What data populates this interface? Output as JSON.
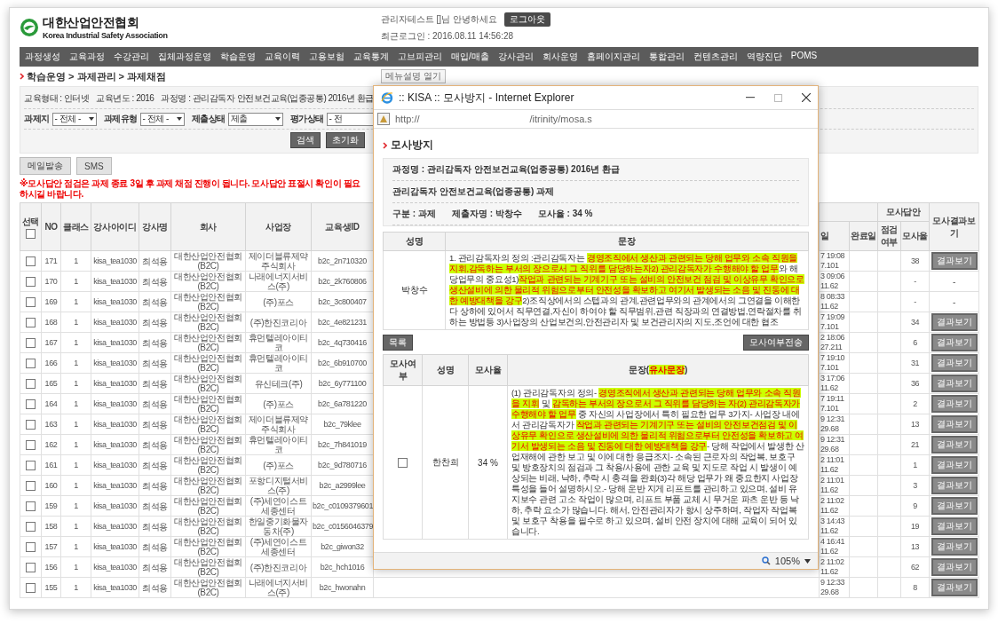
{
  "header": {
    "logo_title": "대한산업안전협회",
    "logo_subtitle": "Korea Industrial Safety Association",
    "greeting": "관리자테스트 []님 안녕하세요",
    "logout": "로그아웃",
    "last_login": "최근로그인 : 2016.08.11 14:56:28"
  },
  "menu": [
    "과정생성",
    "교육과정",
    "수강관리",
    "집체과정운영",
    "학습운영",
    "교육이력",
    "고용보험",
    "교육통계",
    "고브피관리",
    "매입/매출",
    "강사관리",
    "회사운영",
    "홈페이지관리",
    "통합관리",
    "컨텐츠관리",
    "역량진단",
    "POMS"
  ],
  "breadcrumb": "학습운영 > 과제관리 > 과제채점",
  "menu_help": "메뉴설명 열기",
  "filters": {
    "info": [
      "교육형태 : 인터넷",
      "교육년도 : 2016",
      "과정명 : 관리감독자 안전보건교육(업종공통) 2016년 환급"
    ],
    "selects": [
      {
        "label": "과제지",
        "value": "- 전체 -"
      },
      {
        "label": "과제유형",
        "value": "- 전체 -"
      },
      {
        "label": "제출상태",
        "value": "제출"
      },
      {
        "label": "평가상태",
        "value": "- 전"
      }
    ],
    "buttons": [
      "검색",
      "초기화"
    ]
  },
  "actions": [
    "메일발송",
    "SMS"
  ],
  "notice": "※모사답안 점검은 과제 종료 3일 후 과제 채점 진행이 됩니다. 모사답안 표절시 확인이 필요하시길 바랍니다.",
  "table": {
    "select_header": {
      "label": "선택",
      "checked": false
    },
    "columns_left": [
      "NO",
      "클래스",
      "강사아이디",
      "강사명",
      "회사",
      "사업장",
      "교육생ID"
    ],
    "column_9": "일",
    "completed": "완료일",
    "group_header": "모사답안",
    "group_columns": [
      "점검여부",
      "모사율"
    ],
    "result_header": "모사결과보기",
    "rows": [
      {
        "checked": false,
        "no": "171",
        "class": "1",
        "instructor_id": "kisa_tea1030",
        "instructor": "최석용",
        "company": "대한산업안전협회 (B2C)",
        "site": "제이더블류제약 주식회사",
        "student_id": "b2c_2n710320",
        "column_9": "7 19:08\n7.101",
        "rate": "38",
        "result": {
          "kind": "button",
          "label": "결과보기"
        }
      },
      {
        "checked": false,
        "no": "170",
        "class": "1",
        "instructor_id": "kisa_tea1030",
        "instructor": "최석용",
        "company": "대한산업안전협회 (B2C)",
        "site": "나래에너지서비스(주)",
        "student_id": "b2c_2k760806",
        "column_9": "3 09:06\n11.62",
        "rate": "-",
        "result": {
          "kind": "text",
          "label": "-"
        }
      },
      {
        "checked": false,
        "no": "169",
        "class": "1",
        "instructor_id": "kisa_tea1030",
        "instructor": "최석용",
        "company": "대한산업안전협회 (B2C)",
        "site": "(주)포스",
        "student_id": "b2c_3c800407",
        "column_9": "8 08:33\n11.62",
        "rate": "-",
        "result": {
          "kind": "text",
          "label": "-"
        }
      },
      {
        "checked": false,
        "no": "168",
        "class": "1",
        "instructor_id": "kisa_tea1030",
        "instructor": "최석용",
        "company": "대한산업안전협회 (B2C)",
        "site": "(주)한진코리아",
        "student_id": "b2c_4e821231",
        "column_9": "7 19:09\n7.101",
        "rate": "34",
        "result": {
          "kind": "button",
          "label": "결과보기"
        }
      },
      {
        "checked": false,
        "no": "167",
        "class": "1",
        "instructor_id": "kisa_tea1030",
        "instructor": "최석용",
        "company": "대한산업안전협회 (B2C)",
        "site": "휴먼텔레아이티코",
        "student_id": "b2c_4q730416",
        "column_9": "2 18:06\n27.211",
        "rate": "6",
        "result": {
          "kind": "button",
          "label": "결과보기"
        }
      },
      {
        "checked": false,
        "no": "166",
        "class": "1",
        "instructor_id": "kisa_tea1030",
        "instructor": "최석용",
        "company": "대한산업안전협회 (B2C)",
        "site": "휴먼텔레아이티코",
        "student_id": "b2c_6b910700",
        "column_9": "7 19:10\n7.101",
        "rate": "31",
        "result": {
          "kind": "button",
          "label": "결과보기"
        }
      },
      {
        "checked": false,
        "no": "165",
        "class": "1",
        "instructor_id": "kisa_tea1030",
        "instructor": "최석용",
        "company": "대한산업안전협회 (B2C)",
        "site": "유신테크(주)",
        "student_id": "b2c_6y771100",
        "column_9": "3 17:06\n11.62",
        "rate": "36",
        "result": {
          "kind": "button",
          "label": "결과보기"
        }
      },
      {
        "checked": false,
        "no": "164",
        "class": "1",
        "instructor_id": "kisa_tea1030",
        "instructor": "최석용",
        "company": "대한산업안전협회 (B2C)",
        "site": "(주)포스",
        "student_id": "b2c_6a781220",
        "column_9": "7 19:11\n7.101",
        "rate": "2",
        "result": {
          "kind": "button",
          "label": "결과보기"
        }
      },
      {
        "checked": false,
        "no": "163",
        "class": "1",
        "instructor_id": "kisa_tea1030",
        "instructor": "최석용",
        "company": "대한산업안전협회 (B2C)",
        "site": "제이더블류제약 주식회사",
        "student_id": "b2c_79klee",
        "column_9": "9 12:31\n29.68",
        "rate": "13",
        "result": {
          "kind": "button",
          "label": "결과보기"
        }
      },
      {
        "checked": false,
        "no": "162",
        "class": "1",
        "instructor_id": "kisa_tea1030",
        "instructor": "최석용",
        "company": "대한산업안전협회 (B2C)",
        "site": "휴먼텔레아이티코",
        "student_id": "b2c_7h841019",
        "column_9": "9 12:31\n29.68",
        "rate": "21",
        "result": {
          "kind": "button",
          "label": "결과보기"
        }
      },
      {
        "checked": false,
        "no": "161",
        "class": "1",
        "instructor_id": "kisa_tea1030",
        "instructor": "최석용",
        "company": "대한산업안전협회 (B2C)",
        "site": "(주)포스",
        "student_id": "b2c_9d780716",
        "column_9": "2 11:01\n11.62",
        "rate": "1",
        "result": {
          "kind": "button",
          "label": "결과보기"
        }
      },
      {
        "checked": false,
        "no": "160",
        "class": "1",
        "instructor_id": "kisa_tea1030",
        "instructor": "최석용",
        "company": "대한산업안전협회 (B2C)",
        "site": "포항디지털서비스(주)",
        "student_id": "b2c_a2999lee",
        "column_9": "2 11:01\n11.62",
        "rate": "3",
        "result": {
          "kind": "button",
          "label": "결과보기"
        }
      },
      {
        "checked": false,
        "no": "159",
        "class": "1",
        "instructor_id": "kisa_tea1030",
        "instructor": "최석용",
        "company": "대한산업안전협회 (B2C)",
        "site": "(주)세연이스트세종센터",
        "student_id": "b2c_c0109379601",
        "column_9": "2 11:02\n11.62",
        "rate": "9",
        "result": {
          "kind": "button",
          "label": "결과보기"
        }
      },
      {
        "checked": false,
        "no": "158",
        "class": "1",
        "instructor_id": "kisa_tea1030",
        "instructor": "최석용",
        "company": "대한산업안전협회 (B2C)",
        "site": "한일중기화물자동차(주)",
        "student_id": "b2c_c0156046379",
        "column_9": "3 14:43\n11.62",
        "rate": "19",
        "result": {
          "kind": "button",
          "label": "결과보기"
        }
      },
      {
        "checked": false,
        "no": "157",
        "class": "1",
        "instructor_id": "kisa_tea1030",
        "instructor": "최석용",
        "company": "대한산업안전협회 (B2C)",
        "site": "(주)세연이스트세종센터",
        "student_id": "b2c_giwon32",
        "column_9": "4 16:41\n11.62",
        "rate": "13",
        "result": {
          "kind": "button",
          "label": "결과보기"
        }
      },
      {
        "checked": false,
        "no": "156",
        "class": "1",
        "instructor_id": "kisa_tea1030",
        "instructor": "최석용",
        "company": "대한산업안전협회 (B2C)",
        "site": "(주)한진코리아",
        "student_id": "b2c_hch1016",
        "column_9": "2 11:02\n11.62",
        "rate": "62",
        "result": {
          "kind": "button",
          "label": "결과보기"
        }
      },
      {
        "checked": false,
        "no": "155",
        "class": "1",
        "instructor_id": "kisa_tea1030",
        "instructor": "최석용",
        "company": "대한산업안전협회 (B2C)",
        "site": "나래에너지서비스(주)",
        "student_id": "b2c_hwonahn",
        "column_9": "9 12:33\n29.68",
        "rate": "8",
        "result": {
          "kind": "button",
          "label": "결과보기"
        }
      }
    ]
  },
  "popup": {
    "title": ":: KISA :: 모사방지 - Internet Explorer",
    "url_start": "http://",
    "url_end": "/itrinity/mosa.s",
    "heading": "모사방지",
    "info": [
      "과정명 : 관리감독자 안전보건교육(업종공통) 2016년 환급",
      "관리감독자 안전보건교육(업종공통) 과제"
    ],
    "meta": [
      "구분 : 과제",
      "제출자명 : 박창수",
      "모사율 : 34 %"
    ],
    "source_columns": [
      "성명",
      "문장"
    ],
    "source": {
      "name": "박창수",
      "segments": [
        {
          "text": "1. 관리감독자의 정의 :관리감독자는 ",
          "highlighted": false
        },
        {
          "text": "경영조직에서 생산과 관련되는 당해 업무와 소속 직원을 지휘,감독하는 부서의 장으로서 그 직위를 담당하는자2) 관리감독자가 수행해야 할 업무",
          "highlighted": true
        },
        {
          "text": "와 해당업무의 중요성1)",
          "highlighted": false
        },
        {
          "text": "작업과 관련되는 기계기구 또는 설비의 안전보건 점검 및 이상유무 확인으로 생산설비에 의한 물리적 위험으로부터 안전성을 확보하고 여기서 발생되는 소음 및 진동에 대한 예방대책을 강구",
          "highlighted": true
        },
        {
          "text": "2)조직상에서의 스텝과의 관계,관련업무와의 관계에서의 그연결을 이해한다 상하에 있어서 직무연결,자신이 하여야 할 직무범위,관련 직장과의 연결방법,연락절차를 취하는 방법등 3)사업장의 산업보건의,안전관리자 및 보건관리자의 지도,조언에 대한 협조",
          "highlighted": false
        }
      ]
    },
    "buttons": [
      "목록",
      "모사여부전송"
    ],
    "match_columns": [
      "모사여부",
      "성명",
      "모사율"
    ],
    "match_sentence_header": [
      {
        "text": "문장(",
        "highlighted": false
      },
      {
        "text": "유사문장",
        "highlighted": true
      },
      {
        "text": ")",
        "highlighted": false
      }
    ],
    "matches": [
      {
        "checked": false,
        "name": "한찬희",
        "rate": "34 %",
        "segments": [
          {
            "text": "(1) 관리감독자의 정의- ",
            "highlighted": false
          },
          {
            "text": "경영조직에서 생산과 관련되는 당해 업무와 소속 직원을 지휘",
            "highlighted": true
          },
          {
            "text": " 및 ",
            "highlighted": false
          },
          {
            "text": "감독하는 부서의 장으로서 그 직위를 담당하는 자(2) 관리감독자가 수행해야 할 업무",
            "highlighted": true
          },
          {
            "text": " 중 자신의 사업장에서 특히 필요한 업무 3가지- 사업장 내에서 관리감독자가 ",
            "highlighted": false
          },
          {
            "text": "작업과 관련되는 기계기구 또는 설비의 안전보건점검 및 이상유무 확인으로 생산설비에 의한 물리적 위험으로부터 안전성을 확보하고 여기서 발생되는 소음 및 진동에 대한 예방대책을 강구",
            "highlighted": true
          },
          {
            "text": "- 당해 작업에서 발생한 산업재해에 관한 보고 및 이에 대한 응급조치- 소속된 근로자의 작업복, 보호구 및 방호장치의 점검과 그 착용/사용에 관한 교육 및 지도로 작업 시 발생이 예상되는 비래, 낙하, 추락 시 충격을 완화(3)각 해당 업무가 왜 중요한지 사업장 특성을 들어 설명하시오.- 당해 운반 지게 리프트를 관리하고 있으며, 설비 유지보수 관련 고소 작업이 많으며, 리프트 부품 교체 시 무거운 파츠 운반 등 낙하, 추락 요소가 많습니다. 해서, 안전관리자가 항시 상주하며, 작업자 작업복 및 보호구 착용을 필수로 하고 있으며, 설비 안전 장치에 대해 교육이 되어 있습니다.",
            "highlighted": false
          }
        ]
      }
    ],
    "zoom": "105%"
  }
}
